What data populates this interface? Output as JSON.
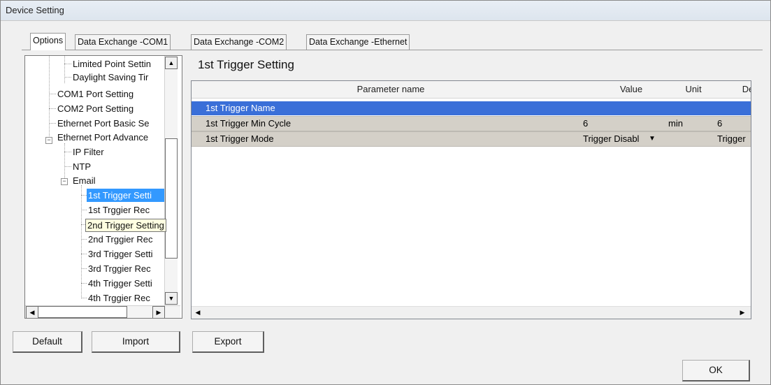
{
  "window": {
    "title": "Device Setting"
  },
  "tabs": [
    "Options",
    "Data Exchange -COM1",
    "Data Exchange -COM2",
    "Data Exchange -Ethernet"
  ],
  "tree": {
    "items": [
      "Limited Point Settin",
      "Daylight Saving Tir",
      "COM1 Port Setting",
      "COM2 Port Setting",
      "Ethernet Port Basic Se",
      "Ethernet Port Advance",
      "IP Filter",
      "NTP",
      "Email",
      "1st Trigger Setti",
      "1st Trggier Rec",
      "2nd Trigger Setting",
      "2nd Trggier Rec",
      "3rd Trigger Setti",
      "3rd Trggier Rec",
      "4th Trigger Setti",
      "4th Trggier Rec"
    ],
    "selected_index": 9,
    "hovered_index": 11
  },
  "panel": {
    "title": "1st Trigger Setting",
    "columns": [
      "Parameter name",
      "Value",
      "Unit",
      "Def"
    ],
    "rows": [
      {
        "name": "1st Trigger Name",
        "value": "",
        "unit": "",
        "default": ""
      },
      {
        "name": "1st Trigger Min Cycle",
        "value": "6",
        "unit": "min",
        "default": "6"
      },
      {
        "name": "1st Trigger Mode",
        "value": "Trigger Disabl",
        "unit": "",
        "default": "Trigger"
      }
    ]
  },
  "buttons": {
    "default": "Default",
    "import": "Import",
    "export": "Export",
    "ok": "OK"
  },
  "colors": {
    "selection": "#3399ff",
    "grid_selection": "#3a6fd8",
    "row_alt": "#d4d0c8"
  }
}
